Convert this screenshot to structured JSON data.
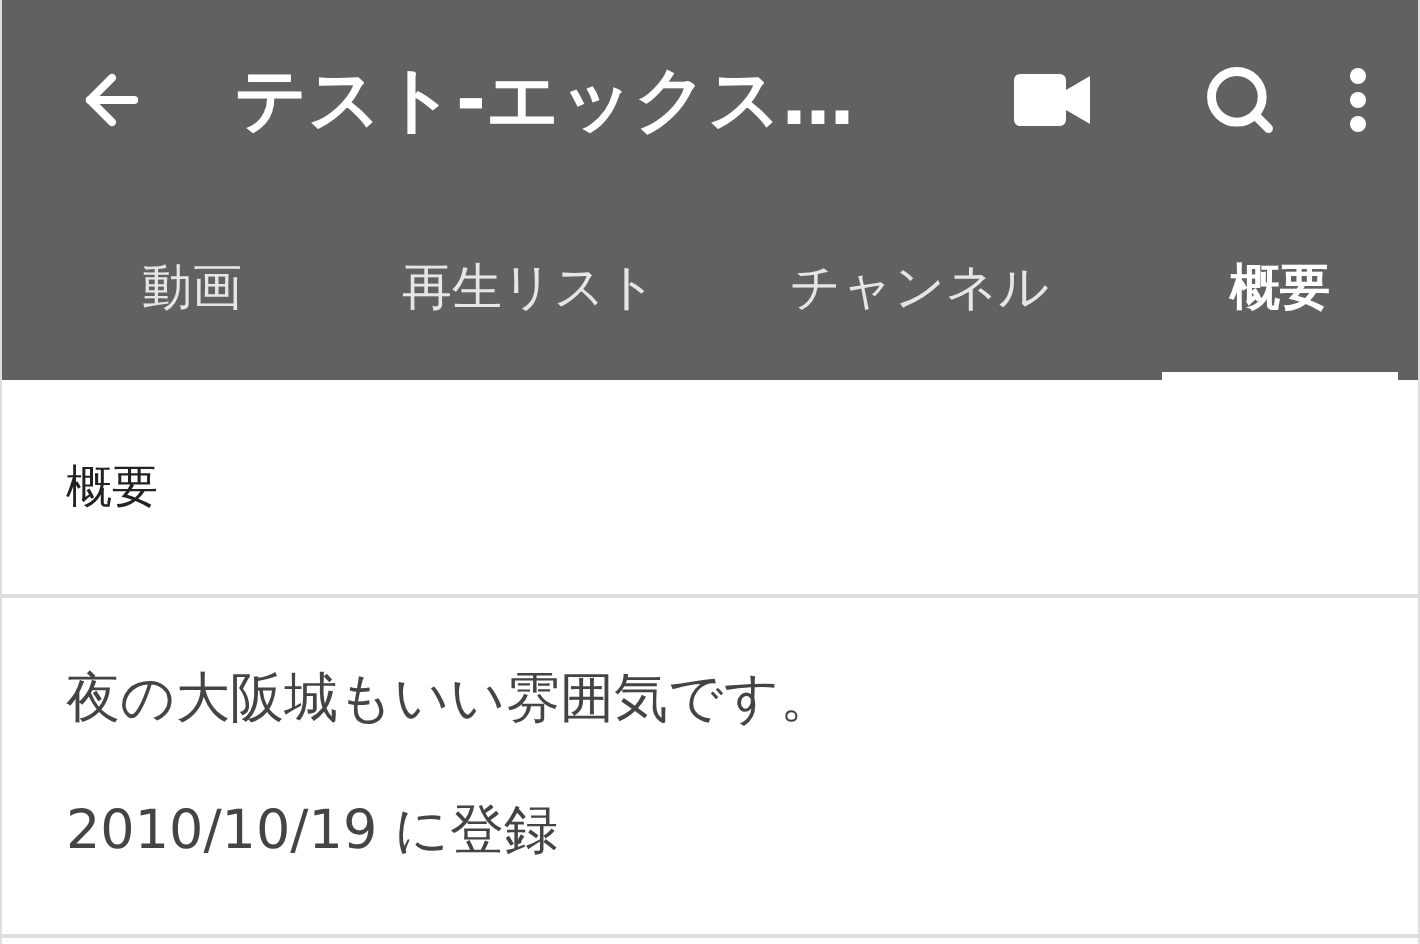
{
  "toolbar": {
    "title": "テスト-エックス…"
  },
  "tabs": [
    {
      "label": "動画",
      "selected": false
    },
    {
      "label": "再生リスト",
      "selected": false
    },
    {
      "label": "チャンネル",
      "selected": false
    },
    {
      "label": "概要",
      "selected": true
    }
  ],
  "section": {
    "title": "概要"
  },
  "description": "夜の大阪城もいい雰囲気です。",
  "registered": "2010/10/19 に登録"
}
